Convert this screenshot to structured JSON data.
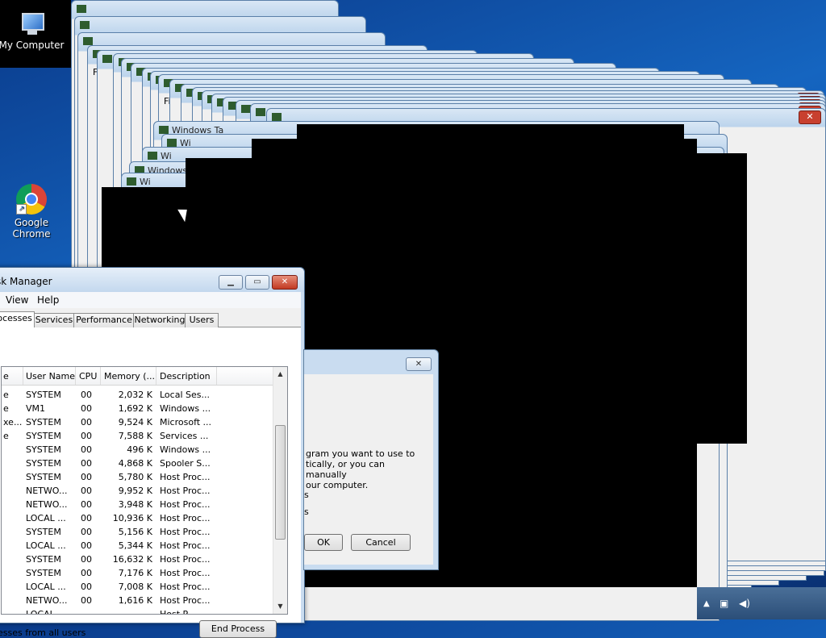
{
  "desktop": {
    "icons": [
      {
        "label": "My Computer"
      },
      {
        "label": "Google\nChrome"
      }
    ]
  },
  "ghost_windows": {
    "menu_fragment": "File",
    "menu_fragment_short": "Fi",
    "title_fragments": [
      "Windows Ta",
      "Wi",
      "Wi"
    ],
    "close_glyph": "✕"
  },
  "task_manager": {
    "title": "sk Manager",
    "menu": [
      "View",
      "Help"
    ],
    "tabs": [
      "rocesses",
      "Services",
      "Performance",
      "Networking",
      "Users"
    ],
    "active_tab": 0,
    "columns": [
      "e",
      "User Name",
      "CPU",
      "Memory (...",
      "Description"
    ],
    "rows": [
      {
        "name": "e",
        "user": "SYSTEM",
        "cpu": "00",
        "mem": "2,032 K",
        "desc": "Local Ses..."
      },
      {
        "name": "e",
        "user": "VM1",
        "cpu": "00",
        "mem": "1,692 K",
        "desc": "Windows ..."
      },
      {
        "name": "xe...",
        "user": "SYSTEM",
        "cpu": "00",
        "mem": "9,524 K",
        "desc": "Microsoft ..."
      },
      {
        "name": "e",
        "user": "SYSTEM",
        "cpu": "00",
        "mem": "7,588 K",
        "desc": "Services ..."
      },
      {
        "name": "",
        "user": "SYSTEM",
        "cpu": "00",
        "mem": "496 K",
        "desc": "Windows ..."
      },
      {
        "name": "",
        "user": "SYSTEM",
        "cpu": "00",
        "mem": "4,868 K",
        "desc": "Spooler S..."
      },
      {
        "name": "",
        "user": "SYSTEM",
        "cpu": "00",
        "mem": "5,780 K",
        "desc": "Host Proc..."
      },
      {
        "name": "",
        "user": "NETWO...",
        "cpu": "00",
        "mem": "9,952 K",
        "desc": "Host Proc..."
      },
      {
        "name": "",
        "user": "NETWO...",
        "cpu": "00",
        "mem": "3,948 K",
        "desc": "Host Proc..."
      },
      {
        "name": "",
        "user": "LOCAL ...",
        "cpu": "00",
        "mem": "10,936 K",
        "desc": "Host Proc..."
      },
      {
        "name": "",
        "user": "SYSTEM",
        "cpu": "00",
        "mem": "5,156 K",
        "desc": "Host Proc..."
      },
      {
        "name": "",
        "user": "LOCAL ...",
        "cpu": "00",
        "mem": "5,344 K",
        "desc": "Host Proc..."
      },
      {
        "name": "",
        "user": "SYSTEM",
        "cpu": "00",
        "mem": "16,632 K",
        "desc": "Host Proc..."
      },
      {
        "name": "",
        "user": "SYSTEM",
        "cpu": "00",
        "mem": "7,176 K",
        "desc": "Host Proc..."
      },
      {
        "name": "",
        "user": "LOCAL ...",
        "cpu": "00",
        "mem": "7,008 K",
        "desc": "Host Proc..."
      },
      {
        "name": "",
        "user": "NETWO...",
        "cpu": "00",
        "mem": "1,616 K",
        "desc": "Host Proc..."
      },
      {
        "name": "",
        "user": "LOCAL ...",
        "cpu": "",
        "mem": "",
        "desc": "Host P..."
      }
    ],
    "show_all_label": "esses from all users",
    "end_process_label": "End Process"
  },
  "dialog": {
    "text_lines": [
      "gram you want to use to",
      "tically, or you can manually",
      "our computer."
    ],
    "fragment_a": "s",
    "fragment_b": "s",
    "ok_label": "OK",
    "cancel_label": "Cancel",
    "close_glyph": "✕"
  },
  "tray": {
    "arrow": "▲",
    "icons": [
      "network-icon",
      "volume-icon"
    ]
  }
}
